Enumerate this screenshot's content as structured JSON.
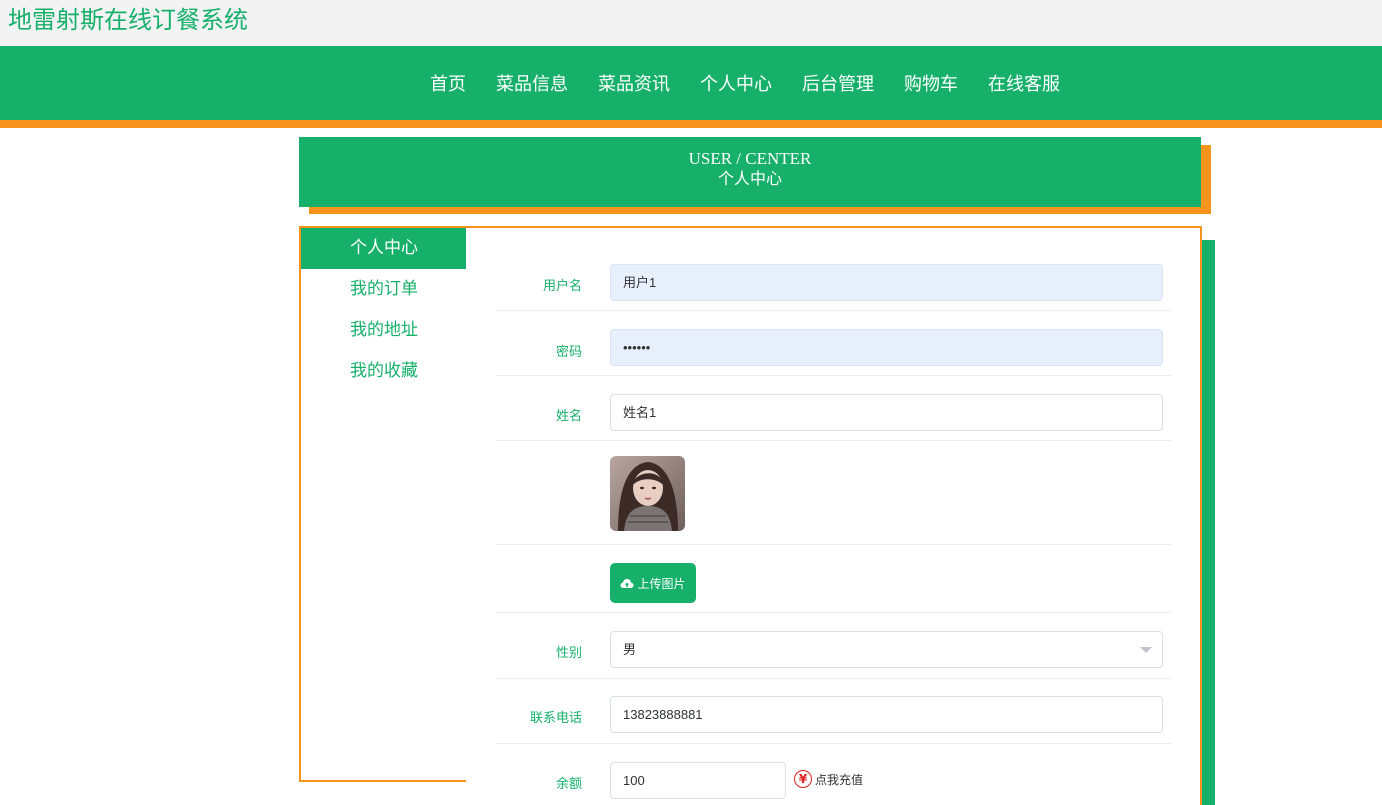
{
  "site": {
    "title": "地雷射斯在线订餐系统"
  },
  "nav": {
    "items": [
      "首页",
      "菜品信息",
      "菜品资讯",
      "个人中心",
      "后台管理",
      "购物车",
      "在线客服"
    ]
  },
  "banner": {
    "en": "USER / CENTER",
    "cn": "个人中心"
  },
  "sidebar": {
    "items": [
      "个人中心",
      "我的订单",
      "我的地址",
      "我的收藏"
    ],
    "active_index": 0
  },
  "form": {
    "username": {
      "label": "用户名",
      "value": "用户1"
    },
    "password": {
      "label": "密码",
      "value": "••••••"
    },
    "name": {
      "label": "姓名",
      "value": "姓名1"
    },
    "upload_label": "上传图片",
    "gender": {
      "label": "性别",
      "value": "男"
    },
    "phone": {
      "label": "联系电话",
      "value": "13823888881"
    },
    "balance": {
      "label": "余额",
      "value": "100",
      "recharge_label": "点我充值",
      "recharge_icon": "¥"
    }
  },
  "colors": {
    "primary": "#16b06a",
    "accent": "#f7941d"
  }
}
